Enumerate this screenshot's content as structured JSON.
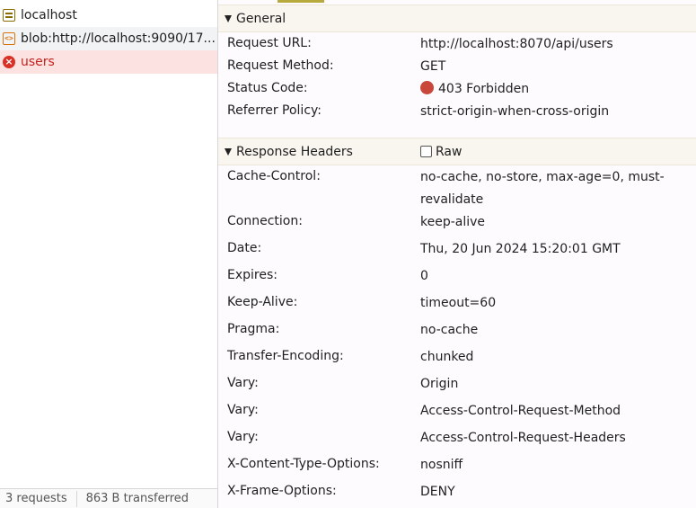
{
  "requests": [
    {
      "label": "localhost",
      "icon": "document-icon"
    },
    {
      "label": "blob:http://localhost:9090/17...",
      "icon": "script-icon"
    },
    {
      "label": "users",
      "icon": "error-icon"
    }
  ],
  "statusbar": {
    "requests": "3 requests",
    "transferred": "863 B transferred"
  },
  "general": {
    "title": "General",
    "request_url_label": "Request URL:",
    "request_url": "http://localhost:8070/api/users",
    "request_method_label": "Request Method:",
    "request_method": "GET",
    "status_code_label": "Status Code:",
    "status_code": "403 Forbidden",
    "status_color": "#c8463a",
    "referrer_policy_label": "Referrer Policy:",
    "referrer_policy": "strict-origin-when-cross-origin"
  },
  "response_headers": {
    "title": "Response Headers",
    "raw_label": "Raw",
    "raw_checked": false,
    "items": [
      {
        "name": "Cache-Control:",
        "value": "no-cache, no-store, max-age=0, must-revalidate"
      },
      {
        "name": "Connection:",
        "value": "keep-alive"
      },
      {
        "name": "Date:",
        "value": "Thu, 20 Jun 2024 15:20:01 GMT"
      },
      {
        "name": "Expires:",
        "value": "0"
      },
      {
        "name": "Keep-Alive:",
        "value": "timeout=60"
      },
      {
        "name": "Pragma:",
        "value": "no-cache"
      },
      {
        "name": "Transfer-Encoding:",
        "value": "chunked"
      },
      {
        "name": "Vary:",
        "value": "Origin"
      },
      {
        "name": "Vary:",
        "value": "Access-Control-Request-Method"
      },
      {
        "name": "Vary:",
        "value": "Access-Control-Request-Headers"
      },
      {
        "name": "X-Content-Type-Options:",
        "value": "nosniff"
      },
      {
        "name": "X-Frame-Options:",
        "value": "DENY"
      }
    ]
  },
  "colors": {
    "error_row_bg": "#fce3e1",
    "error_text": "#c5221f",
    "section_header_bg": "#f9f5ef",
    "tab_accent": "#b8a93c"
  }
}
